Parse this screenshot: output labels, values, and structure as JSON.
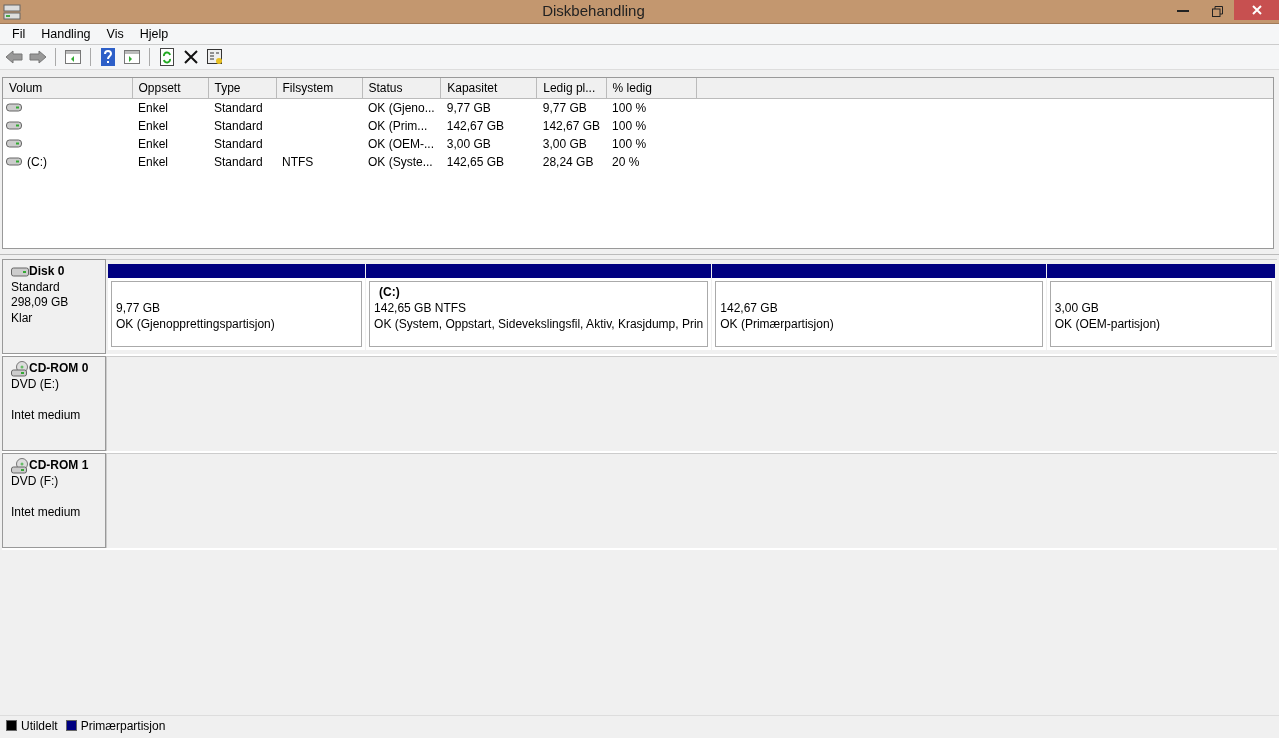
{
  "window": {
    "title": "Diskbehandling"
  },
  "menu": [
    "Fil",
    "Handling",
    "Vis",
    "Hjelp"
  ],
  "volume_table": {
    "columns": [
      "Volum",
      "Oppsett",
      "Type",
      "Filsystem",
      "Status",
      "Kapasitet",
      "Ledig pl...",
      "% ledig"
    ],
    "rows": [
      {
        "layout": "Enkel",
        "type": "Standard",
        "status": "OK (Gjeno...",
        "capacity": "9,77 GB",
        "free": "9,77 GB",
        "percent_free": "100 %"
      },
      {
        "layout": "Enkel",
        "type": "Standard",
        "status": "OK (Prim...",
        "capacity": "142,67 GB",
        "free": "142,67 GB",
        "percent_free": "100 %"
      },
      {
        "layout": "Enkel",
        "type": "Standard",
        "status": "OK (OEM-...",
        "capacity": "3,00 GB",
        "free": "3,00 GB",
        "percent_free": "100 %"
      },
      {
        "volume": "(C:)",
        "layout": "Enkel",
        "type": "Standard",
        "filesystem": "NTFS",
        "status": "OK (Syste...",
        "capacity": "142,65 GB",
        "free": "28,24 GB",
        "percent_free": "20 %"
      }
    ]
  },
  "disks": [
    {
      "kind": "disk",
      "name": "Disk 0",
      "lines": [
        "Standard",
        "298,09 GB",
        "Klar"
      ],
      "partitions": [
        {
          "size": "9,77 GB",
          "status": "OK (Gjenopprettingspartisjon)",
          "color": "#000080"
        },
        {
          "label": "(C:)",
          "size": "142,65 GB NTFS",
          "status": "OK (System, Oppstart, Sidevekslingsfil, Aktiv, Krasjdump, Prin",
          "color": "#000080"
        },
        {
          "size": "142,67 GB",
          "status": "OK (Primærpartisjon)",
          "color": "#000080"
        },
        {
          "size": "3,00 GB",
          "status": "OK (OEM-partisjon)",
          "color": "#000080"
        }
      ]
    },
    {
      "kind": "cdrom",
      "name": "CD-ROM 0",
      "lines": [
        "DVD (E:)",
        "Intet medium"
      ]
    },
    {
      "kind": "cdrom",
      "name": "CD-ROM 1",
      "lines": [
        "DVD (F:)",
        "Intet medium"
      ]
    }
  ],
  "legend": [
    {
      "label": "Utildelt",
      "color": "#000000"
    },
    {
      "label": "Primærpartisjon",
      "color": "#000080"
    }
  ]
}
